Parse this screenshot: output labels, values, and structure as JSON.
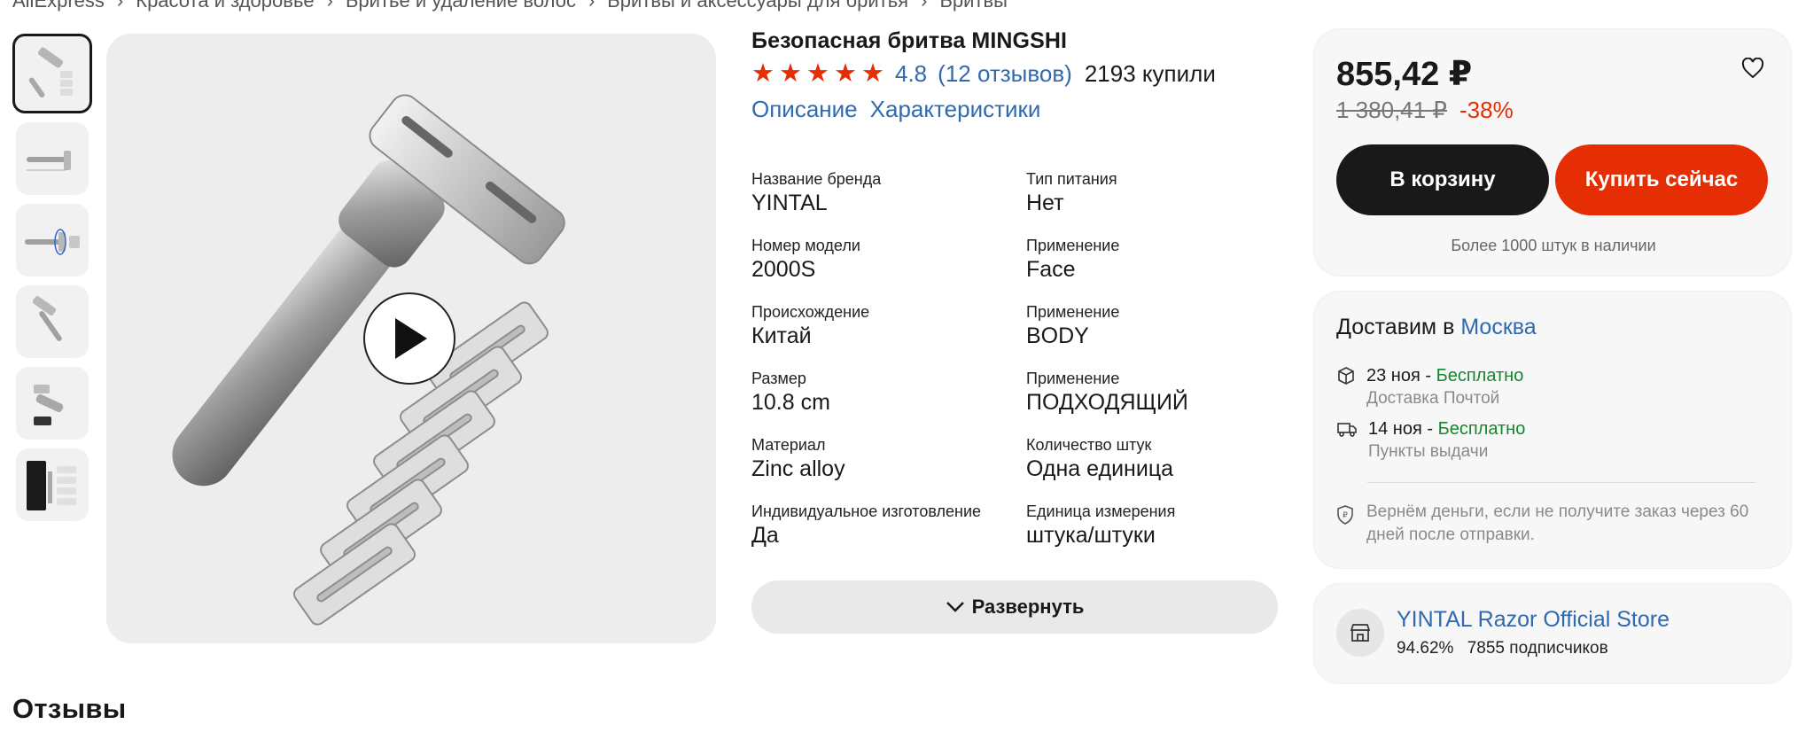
{
  "breadcrumb": [
    "AliExpress",
    "Красота и здоровье",
    "Бритье и удаление волос",
    "Бритвы и аксессуары для бритья",
    "Бритвы"
  ],
  "product": {
    "title": "Безопасная бритва MINGSHI",
    "rating": "4.8",
    "reviews": "(12 отзывов)",
    "sold": "2193 купили",
    "stars": 5
  },
  "tabs": [
    "Описание",
    "Характеристики"
  ],
  "specs": [
    {
      "label": "Название бренда",
      "value": "YINTAL"
    },
    {
      "label": "Тип питания",
      "value": "Нет"
    },
    {
      "label": "Номер модели",
      "value": "2000S"
    },
    {
      "label": "Применение",
      "value": "Face"
    },
    {
      "label": "Происхождение",
      "value": "Китай"
    },
    {
      "label": "Применение",
      "value": "BODY"
    },
    {
      "label": "Размер",
      "value": "10.8 cm"
    },
    {
      "label": "Применение",
      "value": "ПОДХОДЯЩИЙ"
    },
    {
      "label": "Материал",
      "value": "Zinc alloy"
    },
    {
      "label": "Количество штук",
      "value": "Одна единица"
    },
    {
      "label": "Индивидуальное изготовление",
      "value": "Да"
    },
    {
      "label": "Единица измерения",
      "value": "штука/штуки"
    }
  ],
  "expand_label": "Развернуть",
  "price": {
    "current": "855,42 ₽",
    "old": "1 380,41 ₽",
    "discount": "-38%",
    "cart_label": "В корзину",
    "buy_label": "Купить сейчас",
    "stock": "Более 1000 штук в наличии"
  },
  "delivery": {
    "title_prefix": "Доставим в",
    "city": "Москва",
    "options": [
      {
        "date": "23 ноя - ",
        "price": "Бесплатно",
        "method": "Доставка Почтой",
        "icon": "box-icon"
      },
      {
        "date": "14 ноя - ",
        "price": "Бесплатно",
        "method": "Пункты выдачи",
        "icon": "truck-icon"
      }
    ],
    "refund": "Вернём деньги, если не получите заказ через 60 дней после отправки."
  },
  "store": {
    "name": "YINTAL Razor Official Store",
    "rating": "94.62%",
    "followers": "7855 подписчиков"
  },
  "reviews_heading": "Отзывы",
  "colors": {
    "accent_red": "#e62e04",
    "link_blue": "#2f6ab0",
    "green": "#14862b"
  }
}
